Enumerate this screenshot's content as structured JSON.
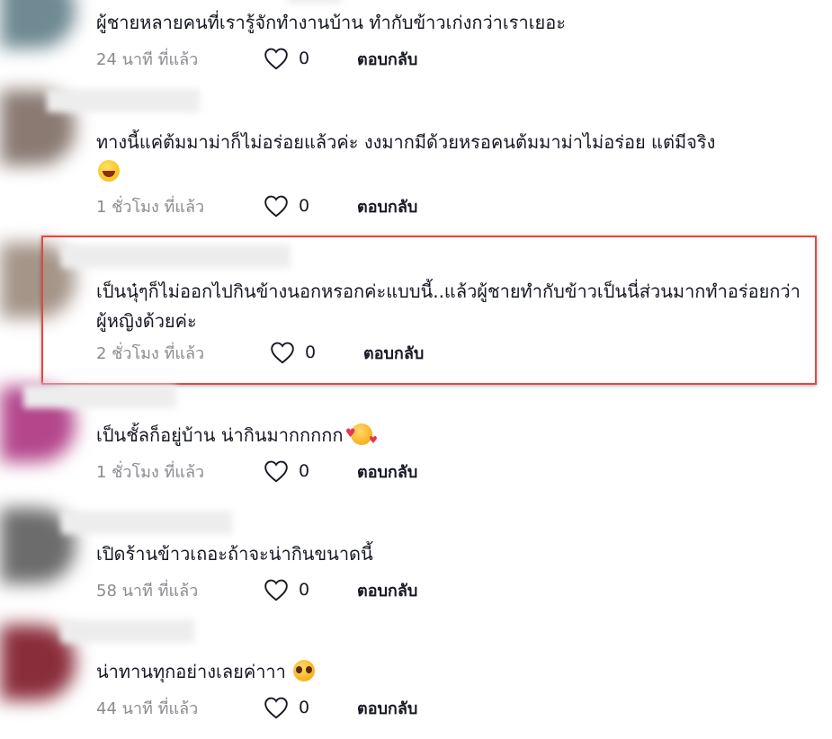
{
  "comments": [
    {
      "text": "ผู้ชายหลายคนที่เรารู้จักทำงานบ้าน ทำกับข้าวเก่งกว่าเราเยอะ",
      "time": "24 นาที ที่แล้ว",
      "likes": "0",
      "reply": "ตอบกลับ",
      "avatar_color": "#6f8a93"
    },
    {
      "text": "ทางนี้แค่ต้มมาม่าก็ไม่อร่อยแล้วค่ะ งงมากมีด้วยหรอคนต้มมาม่าไม่อร่อย แต่มีจริง",
      "emoji": "laughing-with-tears-emoji",
      "time": "1 ชั่วโมง ที่แล้ว",
      "likes": "0",
      "reply": "ตอบกลับ",
      "avatar_color": "#8a7a72"
    },
    {
      "text": "เป็นนุ๋ๆก็ไม่ออกไปกินข้างนอกหรอกค่ะแบบนี้..แล้วผู้ชายทำกับข้าวเป็นนี่ส่วนมากทำอร่อยกว่าผู้หญิงด้วยค่ะ",
      "time": "2 ชั่วโมง ที่แล้ว",
      "likes": "0",
      "reply": "ตอบกลับ",
      "avatar_color": "#a59488",
      "highlighted": true
    },
    {
      "text": "เป็นชั้ลก็อยู่บ้าน น่ากินมากกกกก",
      "emoji": "smiling-face-with-hearts-emoji",
      "time": "1 ชั่วโมง ที่แล้ว",
      "likes": "0",
      "reply": "ตอบกลับ",
      "avatar_color": "#b4478c"
    },
    {
      "text": "เปิดร้านข้าวเถอะถ้าจะน่ากินขนาดนี้",
      "time": "58 นาที ที่แล้ว",
      "likes": "0",
      "reply": "ตอบกลับ",
      "avatar_color": "#6c6c6c"
    },
    {
      "text": "น่าทานทุกอย่างเลยค่าาา",
      "emoji": "pleading-face-emoji",
      "time": "44 นาที ที่แล้ว",
      "likes": "0",
      "reply": "ตอบกลับ",
      "avatar_color": "#8a2d3b"
    }
  ],
  "colors": {
    "highlight_border": "#e8473e",
    "text": "#161823",
    "meta": "#8a8b91"
  },
  "icons": {
    "like": "heart-outline-icon"
  }
}
